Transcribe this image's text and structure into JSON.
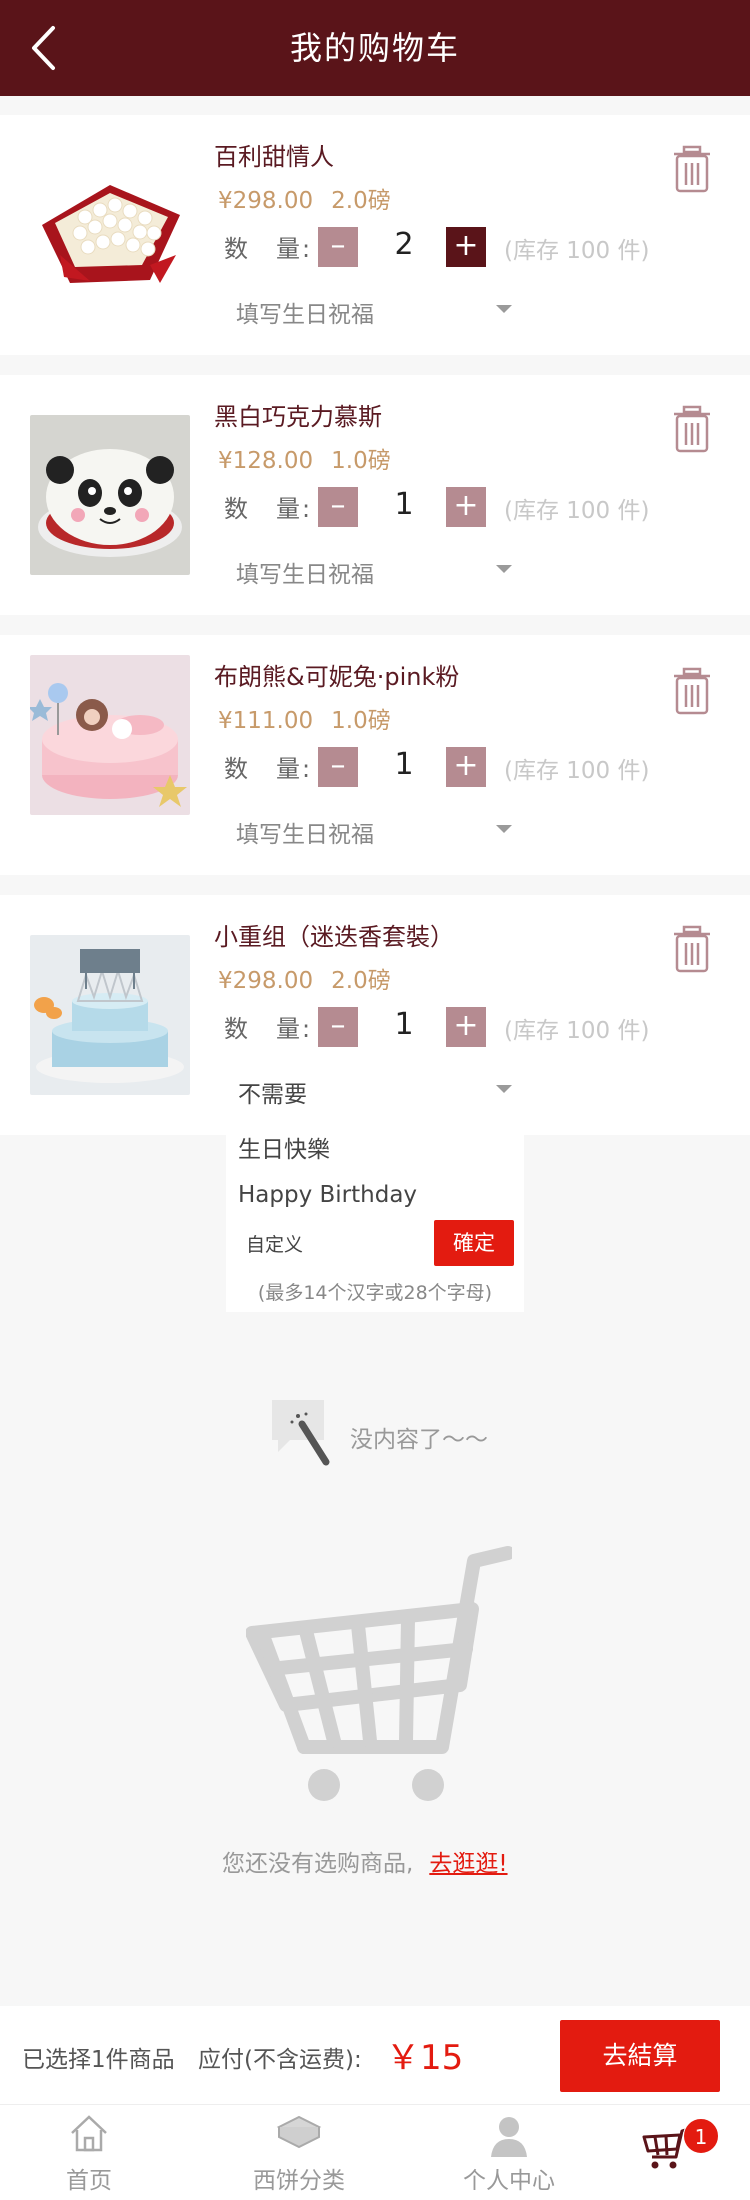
{
  "header": {
    "title": "我的购物车"
  },
  "qty_label": "数　量:",
  "minus_symbol": "–",
  "plus_symbol": "+",
  "items": [
    {
      "name": "百利甜情人",
      "price": "¥298.00",
      "weight": "2.0磅",
      "quantity": "2",
      "stock": "(库存 100 件)",
      "blessing": "填写生日祝福"
    },
    {
      "name": "黑白巧克力慕斯",
      "price": "¥128.00",
      "weight": "1.0磅",
      "quantity": "1",
      "stock": "(库存 100 件)",
      "blessing": "填写生日祝福"
    },
    {
      "name": "布朗熊&可妮兔·pink粉",
      "price": "¥111.00",
      "weight": "1.0磅",
      "quantity": "1",
      "stock": "(库存 100 件)",
      "blessing": "填写生日祝福"
    },
    {
      "name": "小重组（迷迭香套裝）",
      "price": "¥298.00",
      "weight": "2.0磅",
      "quantity": "1",
      "stock": "(库存 100 件)",
      "blessing": "不需要"
    }
  ],
  "blessing_dropdown": {
    "options": [
      "生日快樂",
      "Happy Birthday"
    ],
    "custom_label": "自定义",
    "confirm": "確定",
    "hint": "(最多14个汉字或28个字母)"
  },
  "empty": {
    "no_more": "没内容了～～",
    "message": "您还没有选购商品,",
    "link": "去逛逛!"
  },
  "checkout": {
    "selected": "已选择1件商品",
    "payable_label": "应付(不含运费):",
    "total": "￥15",
    "button": "去結算"
  },
  "tabbar": {
    "tabs": [
      "首页",
      "西饼分类",
      "个人中心"
    ],
    "cart_badge": "1"
  },
  "colors": {
    "brand": "#5a1419",
    "accent": "#e31b10",
    "price": "#c79a6a",
    "stepper": "#b58b91"
  },
  "icons": [
    "back-arrow-icon",
    "trash-icon",
    "caret-down-icon",
    "cart-icon",
    "home-icon",
    "category-icon",
    "user-icon"
  ]
}
